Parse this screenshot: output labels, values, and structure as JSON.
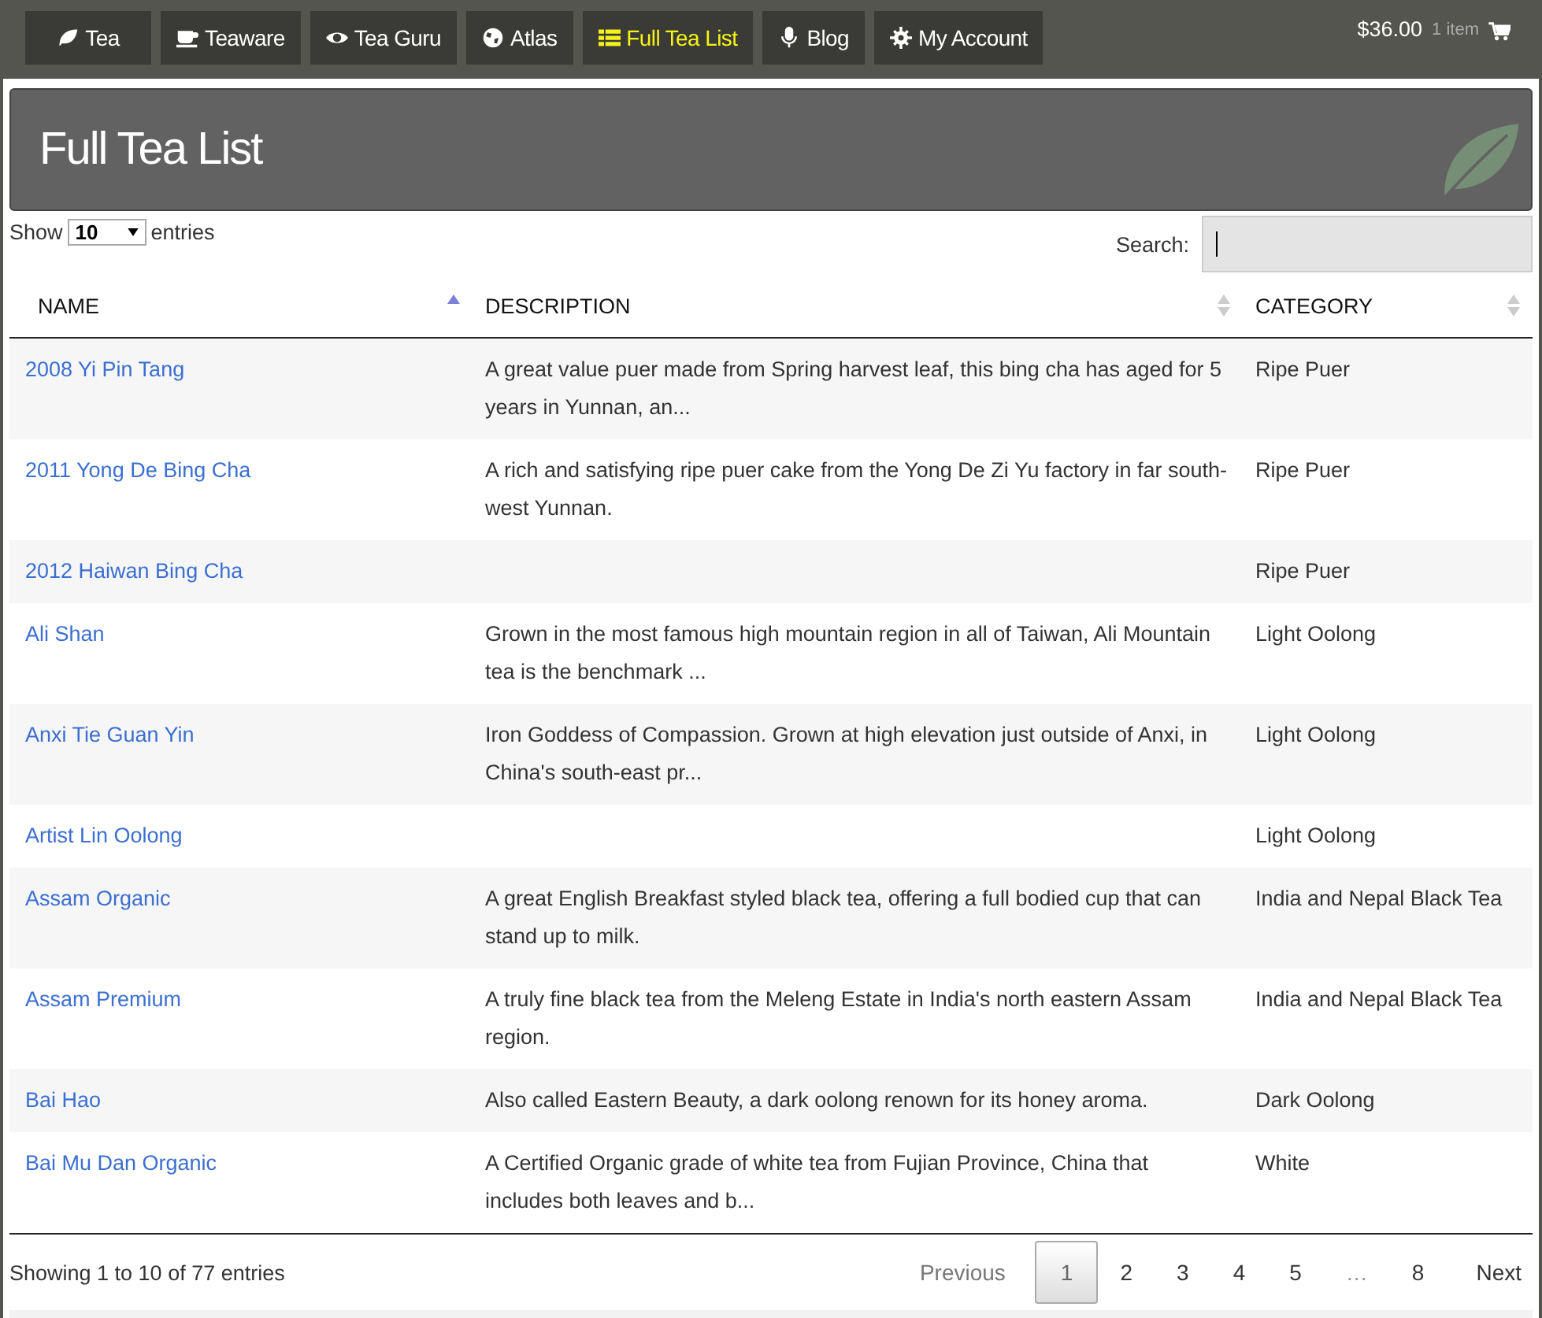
{
  "nav": [
    {
      "label": "Tea",
      "selected": false
    },
    {
      "label": "Teaware",
      "selected": false
    },
    {
      "label": "Tea Guru",
      "selected": false
    },
    {
      "label": "Atlas",
      "selected": false
    },
    {
      "label": "Full Tea List",
      "selected": true
    },
    {
      "label": "Blog",
      "selected": false
    },
    {
      "label": "My Account",
      "selected": false
    }
  ],
  "cart": {
    "total": "$36.00",
    "count": "1 item"
  },
  "page_title": "Full Tea List",
  "length": {
    "before": "Show",
    "value": "10",
    "after": "entries"
  },
  "search": {
    "label": "Search:"
  },
  "table": {
    "columns": [
      {
        "label": "NAME",
        "sorted": true
      },
      {
        "label": "DESCRIPTION",
        "sorted": false
      },
      {
        "label": "CATEGORY",
        "sorted": false
      }
    ],
    "rows": [
      [
        "2008 Yi Pin Tang",
        "A great value puer made from Spring harvest leaf, this bing cha has aged for 5 years in Yunnan, an...",
        "Ripe Puer"
      ],
      [
        "2011 Yong De Bing Cha",
        "A rich and satisfying ripe puer cake from the Yong De Zi Yu factory in far south-west Yunnan.",
        "Ripe Puer"
      ],
      [
        "2012 Haiwan Bing Cha",
        "",
        "Ripe Puer"
      ],
      [
        "Ali Shan",
        "Grown in the most famous high mountain region in all of Taiwan, Ali Mountain tea is the benchmark ...",
        "Light Oolong"
      ],
      [
        "Anxi Tie Guan Yin",
        "Iron Goddess of Compassion. Grown at high elevation just outside of Anxi, in China's south-east pr...",
        "Light Oolong"
      ],
      [
        "Artist Lin Oolong",
        "",
        "Light Oolong"
      ],
      [
        "Assam Organic",
        "A great English Breakfast styled black tea, offering a full bodied cup that can stand up to milk.",
        "India and Nepal Black Tea"
      ],
      [
        "Assam Premium",
        "A truly fine black tea from the Meleng Estate in India's north eastern Assam region.",
        "India and Nepal Black Tea"
      ],
      [
        "Bai Hao",
        "Also called Eastern Beauty, a dark oolong renown for its honey aroma.",
        "Dark Oolong"
      ],
      [
        "Bai Mu Dan Organic",
        "A Certified Organic grade of white tea from Fujian Province, China that includes both leaves and b...",
        "White"
      ]
    ]
  },
  "info": "Showing 1 to 10 of 77 entries",
  "pagination": [
    {
      "kind": "prev",
      "label": "Previous",
      "disabled": true
    },
    {
      "kind": "page",
      "label": "1",
      "selected": true
    },
    {
      "kind": "page",
      "label": "2",
      "selected": false
    },
    {
      "kind": "page",
      "label": "3",
      "selected": false
    },
    {
      "kind": "page",
      "label": "4",
      "selected": false
    },
    {
      "kind": "page",
      "label": "5",
      "selected": false
    },
    {
      "kind": "ellipsis",
      "label": "…"
    },
    {
      "kind": "page",
      "label": "8",
      "selected": false
    },
    {
      "kind": "next",
      "label": "Next",
      "disabled": false
    }
  ]
}
